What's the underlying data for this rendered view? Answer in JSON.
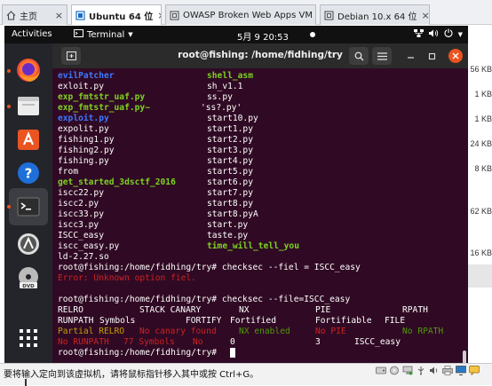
{
  "host_tabs": [
    {
      "label": "主页",
      "icon": "home-icon"
    },
    {
      "label": "Ubuntu 64 位",
      "icon": "vm-icon"
    },
    {
      "label": "OWASP Broken Web Apps VM v...",
      "icon": "vm-icon"
    },
    {
      "label": "Debian 10.x 64 位",
      "icon": "vm-icon"
    }
  ],
  "host_file_sizes": [
    "56 KB",
    "1 KB",
    "1 KB",
    "24 KB",
    "8 KB",
    "62 KB",
    "16 KB"
  ],
  "topbar": {
    "activities": "Activities",
    "app_menu": "Terminal",
    "clock": "5月 9 20:53"
  },
  "dock": {
    "apps": [
      "firefox-icon",
      "files-icon",
      "software-icon",
      "help-icon",
      "terminal-icon",
      "updater-icon",
      "dvd-icon",
      "app-grid-icon"
    ],
    "accent": "#e95420"
  },
  "terminal": {
    "title": "root@fishing: /home/fidhing/try",
    "listing": [
      {
        "left": "evilPatcher",
        "left_style": "blue",
        "right": "shell_asm",
        "right_style": "green"
      },
      {
        "left": "exloit.py",
        "left_style": "",
        "right": "sh_v1.1",
        "right_style": ""
      },
      {
        "left": "exp_fmtstr_uaf.py",
        "left_style": "green",
        "right": "ss.py",
        "right_style": ""
      },
      {
        "left": "exp_fmtstr_uaf.py~",
        "left_style": "green",
        "right": "'ss?.py'",
        "right_style": ""
      },
      {
        "left": "exploit.py",
        "left_style": "blue",
        "right": "start10.py",
        "right_style": ""
      },
      {
        "left": "expolit.py",
        "left_style": "",
        "right": "start1.py",
        "right_style": ""
      },
      {
        "left": "fishing1.py",
        "left_style": "",
        "right": "start2.py",
        "right_style": ""
      },
      {
        "left": "fishing2.py",
        "left_style": "",
        "right": "start3.py",
        "right_style": ""
      },
      {
        "left": "fishing.py",
        "left_style": "",
        "right": "start4.py",
        "right_style": ""
      },
      {
        "left": "from",
        "left_style": "",
        "right": "start5.py",
        "right_style": ""
      },
      {
        "left": "get_started_3dsctf_2016",
        "left_style": "green",
        "right": "start6.py",
        "right_style": ""
      },
      {
        "left": "iscc22.py",
        "left_style": "",
        "right": "start7.py",
        "right_style": ""
      },
      {
        "left": "iscc2.py",
        "left_style": "",
        "right": "start8.py",
        "right_style": ""
      },
      {
        "left": "iscc33.py",
        "left_style": "",
        "right": "start8.pyA",
        "right_style": ""
      },
      {
        "left": "iscc3.py",
        "left_style": "",
        "right": "start.py",
        "right_style": ""
      },
      {
        "left": "ISCC_easy",
        "left_style": "",
        "right": "taste.py",
        "right_style": ""
      },
      {
        "left": "iscc_easy.py",
        "left_style": "",
        "right": "time_will_tell_you",
        "right_style": "green"
      },
      {
        "left": "ld-2.27.so",
        "left_style": "",
        "right": "",
        "right_style": ""
      }
    ],
    "cmd1": "root@fishing:/home/fidhing/try# checksec --fiel = ISCC_easy",
    "err1": "Error: Unknown option fiel.",
    "cmd2": "root@fishing:/home/fidhing/try# checksec --file=ISCC_easy",
    "hdr1": {
      "relro": "RELRO",
      "canary": "STACK CANARY",
      "nx": "NX",
      "pie": "PIE",
      "rpath": "RPATH"
    },
    "hdr2": {
      "runpath": "RUNPATH",
      "symbols": "Symbols",
      "fortify": "FORTIFY",
      "fortified": "Fortified",
      "fortifiable": "Fortifiable",
      "file": "FILE"
    },
    "row1": {
      "relro": "Partial RELRO",
      "canary": "No canary found",
      "nx": "NX enabled",
      "pie": "No PIE",
      "rpath": "No RPATH"
    },
    "row2": {
      "runpath": "No RUNPATH",
      "symbols": "77 Symbols",
      "fortify": "No",
      "fortified": "0",
      "fortifiable": "3",
      "file": "ISCC_easy"
    },
    "prompt": "root@fishing:/home/fidhing/try#"
  },
  "statusbar": {
    "message": "要将输入定向到该虚拟机，请将鼠标指针移入其中或按 Ctrl+G。"
  }
}
